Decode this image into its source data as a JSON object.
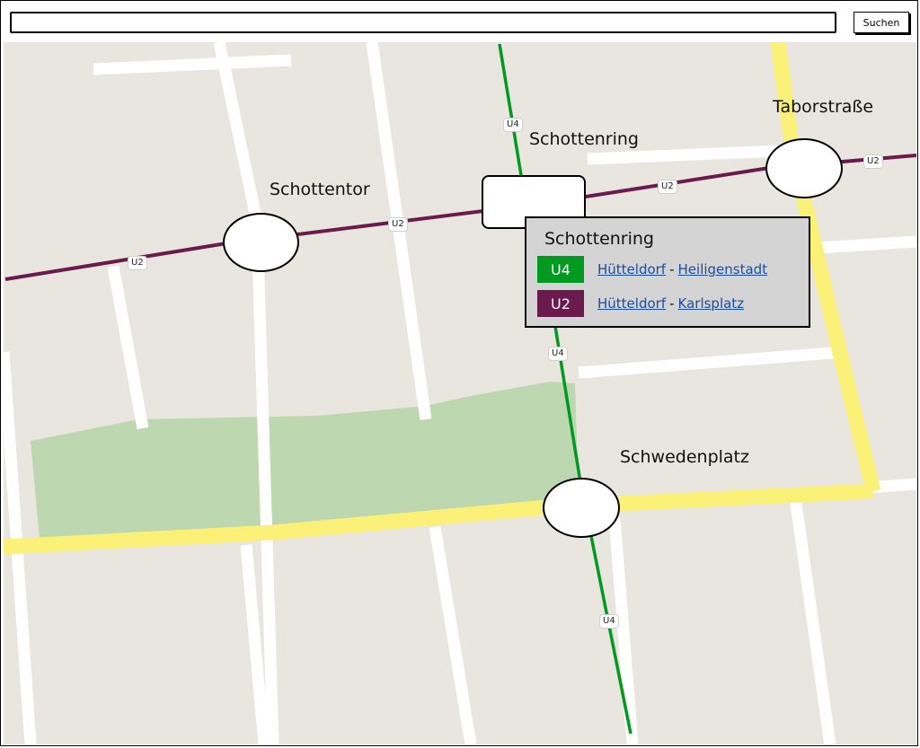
{
  "search": {
    "value": "",
    "placeholder": "",
    "button_label": "Suchen"
  },
  "map": {
    "colors": {
      "background": "#e9e6df",
      "street": "#ffffff",
      "main_road": "#fbf179",
      "park": "#bdd7b0",
      "u4": "#009a20",
      "u2": "#6a1a4d"
    },
    "line_tags": {
      "u2": "U2",
      "u4": "U4"
    },
    "stations": {
      "schottentor": "Schottentor",
      "schottenring": "Schottenring",
      "taborstrasse": "Taborstraße",
      "schwedenplatz": "Schwedenplatz"
    }
  },
  "popup": {
    "title": "Schottenring",
    "routes": [
      {
        "line": "U4",
        "color": "#009a20",
        "from": "Hütteldorf",
        "separator": "-",
        "to": "Heiligenstadt"
      },
      {
        "line": "U2",
        "color": "#6a1a4d",
        "from": "Hütteldorf",
        "separator": "-",
        "to": "Karlsplatz"
      }
    ]
  }
}
